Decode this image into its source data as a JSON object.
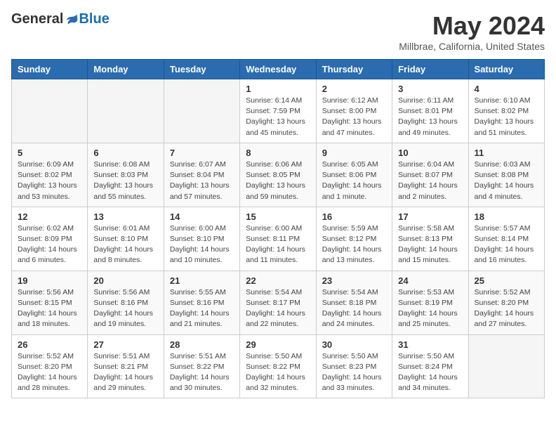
{
  "logo": {
    "general": "General",
    "blue": "Blue"
  },
  "header": {
    "title": "May 2024",
    "subtitle": "Millbrae, California, United States"
  },
  "weekdays": [
    "Sunday",
    "Monday",
    "Tuesday",
    "Wednesday",
    "Thursday",
    "Friday",
    "Saturday"
  ],
  "weeks": [
    [
      {
        "day": "",
        "sunrise": "",
        "sunset": "",
        "daylight": "",
        "empty": true
      },
      {
        "day": "",
        "sunrise": "",
        "sunset": "",
        "daylight": "",
        "empty": true
      },
      {
        "day": "",
        "sunrise": "",
        "sunset": "",
        "daylight": "",
        "empty": true
      },
      {
        "day": "1",
        "sunrise": "Sunrise: 6:14 AM",
        "sunset": "Sunset: 7:59 PM",
        "daylight": "Daylight: 13 hours and 45 minutes."
      },
      {
        "day": "2",
        "sunrise": "Sunrise: 6:12 AM",
        "sunset": "Sunset: 8:00 PM",
        "daylight": "Daylight: 13 hours and 47 minutes."
      },
      {
        "day": "3",
        "sunrise": "Sunrise: 6:11 AM",
        "sunset": "Sunset: 8:01 PM",
        "daylight": "Daylight: 13 hours and 49 minutes."
      },
      {
        "day": "4",
        "sunrise": "Sunrise: 6:10 AM",
        "sunset": "Sunset: 8:02 PM",
        "daylight": "Daylight: 13 hours and 51 minutes."
      }
    ],
    [
      {
        "day": "5",
        "sunrise": "Sunrise: 6:09 AM",
        "sunset": "Sunset: 8:02 PM",
        "daylight": "Daylight: 13 hours and 53 minutes."
      },
      {
        "day": "6",
        "sunrise": "Sunrise: 6:08 AM",
        "sunset": "Sunset: 8:03 PM",
        "daylight": "Daylight: 13 hours and 55 minutes."
      },
      {
        "day": "7",
        "sunrise": "Sunrise: 6:07 AM",
        "sunset": "Sunset: 8:04 PM",
        "daylight": "Daylight: 13 hours and 57 minutes."
      },
      {
        "day": "8",
        "sunrise": "Sunrise: 6:06 AM",
        "sunset": "Sunset: 8:05 PM",
        "daylight": "Daylight: 13 hours and 59 minutes."
      },
      {
        "day": "9",
        "sunrise": "Sunrise: 6:05 AM",
        "sunset": "Sunset: 8:06 PM",
        "daylight": "Daylight: 14 hours and 1 minute."
      },
      {
        "day": "10",
        "sunrise": "Sunrise: 6:04 AM",
        "sunset": "Sunset: 8:07 PM",
        "daylight": "Daylight: 14 hours and 2 minutes."
      },
      {
        "day": "11",
        "sunrise": "Sunrise: 6:03 AM",
        "sunset": "Sunset: 8:08 PM",
        "daylight": "Daylight: 14 hours and 4 minutes."
      }
    ],
    [
      {
        "day": "12",
        "sunrise": "Sunrise: 6:02 AM",
        "sunset": "Sunset: 8:09 PM",
        "daylight": "Daylight: 14 hours and 6 minutes."
      },
      {
        "day": "13",
        "sunrise": "Sunrise: 6:01 AM",
        "sunset": "Sunset: 8:10 PM",
        "daylight": "Daylight: 14 hours and 8 minutes."
      },
      {
        "day": "14",
        "sunrise": "Sunrise: 6:00 AM",
        "sunset": "Sunset: 8:10 PM",
        "daylight": "Daylight: 14 hours and 10 minutes."
      },
      {
        "day": "15",
        "sunrise": "Sunrise: 6:00 AM",
        "sunset": "Sunset: 8:11 PM",
        "daylight": "Daylight: 14 hours and 11 minutes."
      },
      {
        "day": "16",
        "sunrise": "Sunrise: 5:59 AM",
        "sunset": "Sunset: 8:12 PM",
        "daylight": "Daylight: 14 hours and 13 minutes."
      },
      {
        "day": "17",
        "sunrise": "Sunrise: 5:58 AM",
        "sunset": "Sunset: 8:13 PM",
        "daylight": "Daylight: 14 hours and 15 minutes."
      },
      {
        "day": "18",
        "sunrise": "Sunrise: 5:57 AM",
        "sunset": "Sunset: 8:14 PM",
        "daylight": "Daylight: 14 hours and 16 minutes."
      }
    ],
    [
      {
        "day": "19",
        "sunrise": "Sunrise: 5:56 AM",
        "sunset": "Sunset: 8:15 PM",
        "daylight": "Daylight: 14 hours and 18 minutes."
      },
      {
        "day": "20",
        "sunrise": "Sunrise: 5:56 AM",
        "sunset": "Sunset: 8:16 PM",
        "daylight": "Daylight: 14 hours and 19 minutes."
      },
      {
        "day": "21",
        "sunrise": "Sunrise: 5:55 AM",
        "sunset": "Sunset: 8:16 PM",
        "daylight": "Daylight: 14 hours and 21 minutes."
      },
      {
        "day": "22",
        "sunrise": "Sunrise: 5:54 AM",
        "sunset": "Sunset: 8:17 PM",
        "daylight": "Daylight: 14 hours and 22 minutes."
      },
      {
        "day": "23",
        "sunrise": "Sunrise: 5:54 AM",
        "sunset": "Sunset: 8:18 PM",
        "daylight": "Daylight: 14 hours and 24 minutes."
      },
      {
        "day": "24",
        "sunrise": "Sunrise: 5:53 AM",
        "sunset": "Sunset: 8:19 PM",
        "daylight": "Daylight: 14 hours and 25 minutes."
      },
      {
        "day": "25",
        "sunrise": "Sunrise: 5:52 AM",
        "sunset": "Sunset: 8:20 PM",
        "daylight": "Daylight: 14 hours and 27 minutes."
      }
    ],
    [
      {
        "day": "26",
        "sunrise": "Sunrise: 5:52 AM",
        "sunset": "Sunset: 8:20 PM",
        "daylight": "Daylight: 14 hours and 28 minutes."
      },
      {
        "day": "27",
        "sunrise": "Sunrise: 5:51 AM",
        "sunset": "Sunset: 8:21 PM",
        "daylight": "Daylight: 14 hours and 29 minutes."
      },
      {
        "day": "28",
        "sunrise": "Sunrise: 5:51 AM",
        "sunset": "Sunset: 8:22 PM",
        "daylight": "Daylight: 14 hours and 30 minutes."
      },
      {
        "day": "29",
        "sunrise": "Sunrise: 5:50 AM",
        "sunset": "Sunset: 8:22 PM",
        "daylight": "Daylight: 14 hours and 32 minutes."
      },
      {
        "day": "30",
        "sunrise": "Sunrise: 5:50 AM",
        "sunset": "Sunset: 8:23 PM",
        "daylight": "Daylight: 14 hours and 33 minutes."
      },
      {
        "day": "31",
        "sunrise": "Sunrise: 5:50 AM",
        "sunset": "Sunset: 8:24 PM",
        "daylight": "Daylight: 14 hours and 34 minutes."
      },
      {
        "day": "",
        "sunrise": "",
        "sunset": "",
        "daylight": "",
        "empty": true
      }
    ]
  ]
}
